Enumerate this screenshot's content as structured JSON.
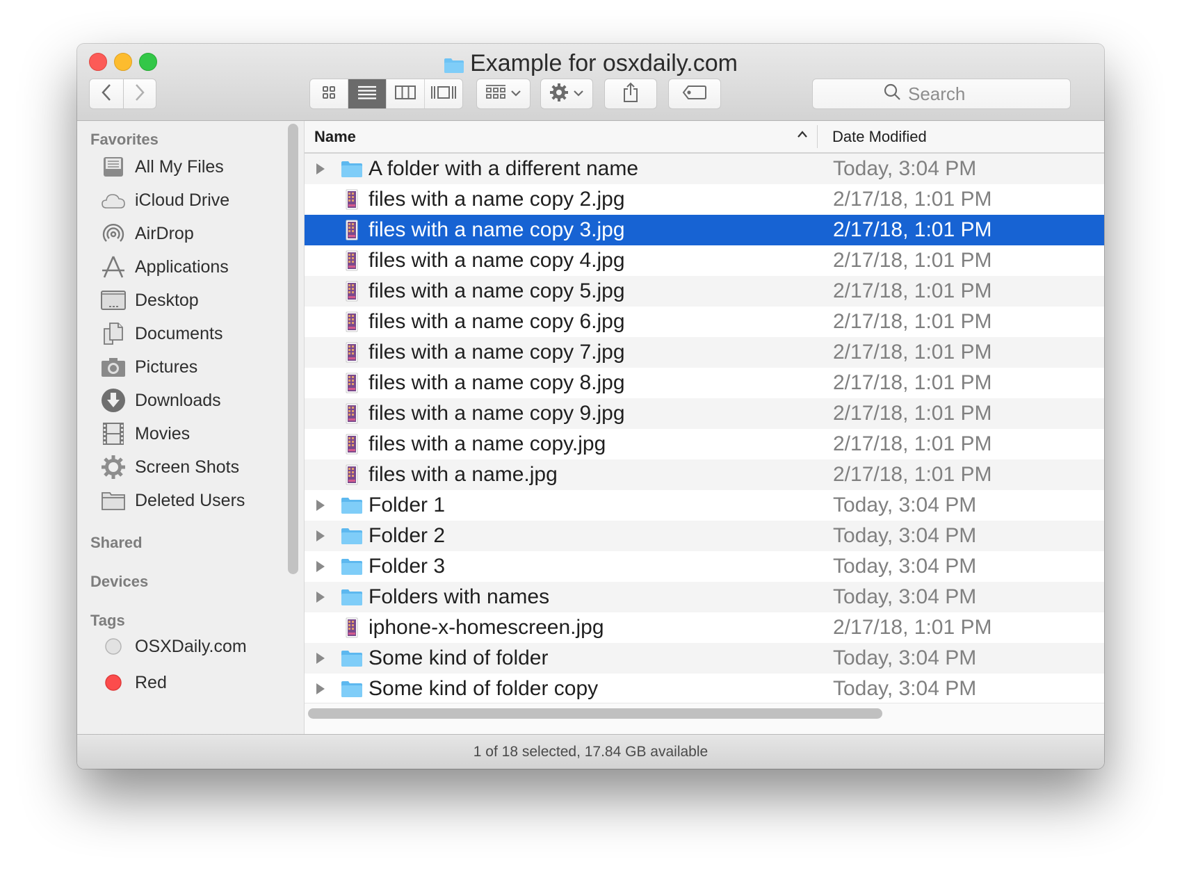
{
  "window": {
    "title": "Example for osxdaily.com",
    "title_icon": "folder-icon"
  },
  "toolbar": {
    "back": "back-chevron-icon",
    "forward": "forward-chevron-icon",
    "view_modes": [
      "icon-view",
      "list-view",
      "column-view",
      "cover-flow-view"
    ],
    "active_view": "list-view",
    "arrange": "arrange-grid-icon",
    "action": "gear-icon",
    "share": "share-icon",
    "tags": "tag-icon",
    "search_placeholder": "Search"
  },
  "sidebar": {
    "favorites_heading": "Favorites",
    "favorites": [
      {
        "label": "All My Files",
        "icon": "all-files-icon"
      },
      {
        "label": "iCloud Drive",
        "icon": "cloud-icon"
      },
      {
        "label": "AirDrop",
        "icon": "airdrop-icon"
      },
      {
        "label": "Applications",
        "icon": "applications-icon"
      },
      {
        "label": "Desktop",
        "icon": "desktop-icon"
      },
      {
        "label": "Documents",
        "icon": "documents-icon"
      },
      {
        "label": "Pictures",
        "icon": "camera-icon"
      },
      {
        "label": "Downloads",
        "icon": "download-icon"
      },
      {
        "label": "Movies",
        "icon": "film-icon"
      },
      {
        "label": "Screen Shots",
        "icon": "gear-icon"
      },
      {
        "label": "Deleted Users",
        "icon": "folder-icon"
      }
    ],
    "shared_heading": "Shared",
    "devices_heading": "Devices",
    "tags_heading": "Tags",
    "tags": [
      {
        "label": "OSXDaily.com",
        "color": "#e0e0e0"
      },
      {
        "label": "Red",
        "color": "#fc4c4c"
      }
    ]
  },
  "columns": {
    "name": "Name",
    "date": "Date Modified",
    "sort_indicator": "^"
  },
  "files": [
    {
      "name": "A folder with a different name",
      "date": "Today, 3:04 PM",
      "type": "folder",
      "selected": false
    },
    {
      "name": "files with a name copy 2.jpg",
      "date": "2/17/18, 1:01 PM",
      "type": "image",
      "selected": false
    },
    {
      "name": "files with a name copy 3.jpg",
      "date": "2/17/18, 1:01 PM",
      "type": "image",
      "selected": true
    },
    {
      "name": "files with a name copy 4.jpg",
      "date": "2/17/18, 1:01 PM",
      "type": "image",
      "selected": false
    },
    {
      "name": "files with a name copy 5.jpg",
      "date": "2/17/18, 1:01 PM",
      "type": "image",
      "selected": false
    },
    {
      "name": "files with a name copy 6.jpg",
      "date": "2/17/18, 1:01 PM",
      "type": "image",
      "selected": false
    },
    {
      "name": "files with a name copy 7.jpg",
      "date": "2/17/18, 1:01 PM",
      "type": "image",
      "selected": false
    },
    {
      "name": "files with a name copy 8.jpg",
      "date": "2/17/18, 1:01 PM",
      "type": "image",
      "selected": false
    },
    {
      "name": "files with a name copy 9.jpg",
      "date": "2/17/18, 1:01 PM",
      "type": "image",
      "selected": false
    },
    {
      "name": "files with a name copy.jpg",
      "date": "2/17/18, 1:01 PM",
      "type": "image",
      "selected": false
    },
    {
      "name": "files with a name.jpg",
      "date": "2/17/18, 1:01 PM",
      "type": "image",
      "selected": false
    },
    {
      "name": "Folder 1",
      "date": "Today, 3:04 PM",
      "type": "folder",
      "selected": false
    },
    {
      "name": "Folder 2",
      "date": "Today, 3:04 PM",
      "type": "folder",
      "selected": false
    },
    {
      "name": "Folder 3",
      "date": "Today, 3:04 PM",
      "type": "folder",
      "selected": false
    },
    {
      "name": "Folders with names",
      "date": "Today, 3:04 PM",
      "type": "folder",
      "selected": false
    },
    {
      "name": "iphone-x-homescreen.jpg",
      "date": "2/17/18, 1:01 PM",
      "type": "image",
      "selected": false
    },
    {
      "name": "Some kind of folder",
      "date": "Today, 3:04 PM",
      "type": "folder",
      "selected": false
    },
    {
      "name": "Some kind of folder copy",
      "date": "Today, 3:04 PM",
      "type": "folder",
      "selected": false
    }
  ],
  "status": "1 of 18 selected, 17.84 GB available",
  "colors": {
    "selection": "#1763d3",
    "folder": "#6ec3f4",
    "close": "#fc5b57",
    "minimize": "#fdbc2e",
    "zoom": "#33c748"
  }
}
